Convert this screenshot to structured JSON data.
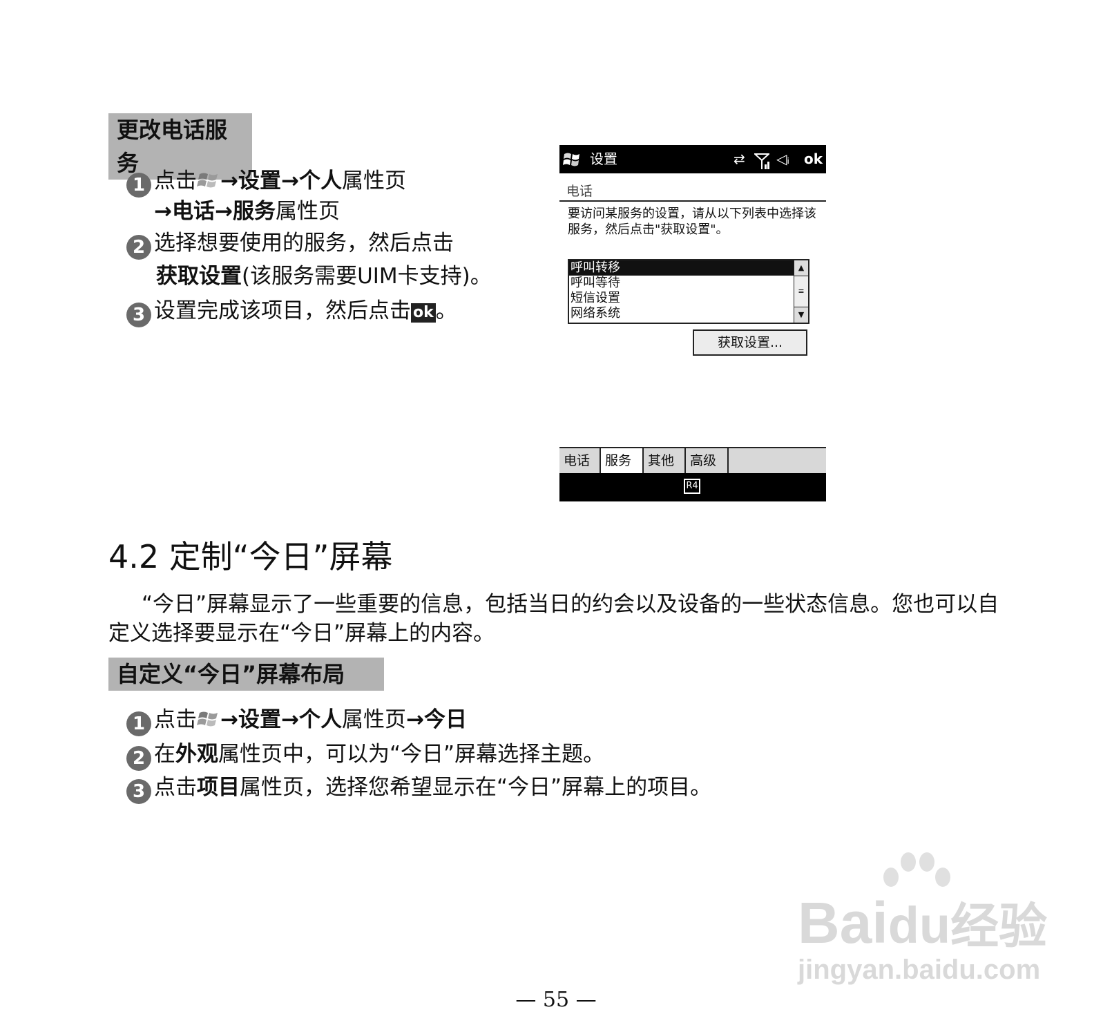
{
  "section1": {
    "label": "更改电话服务",
    "step1": {
      "num": "1",
      "pre": "点击",
      "arrow1": "→",
      "b1": "设置",
      "arrow2": "→",
      "b2": "个人",
      "tail": "属性页"
    },
    "step1b": {
      "arrow3": "→",
      "b3": "电话",
      "arrow4": "→",
      "b4": "服务",
      "tail": "属性页"
    },
    "step2": {
      "num": "2",
      "text": "选择想要使用的服务，然后点击"
    },
    "step2b": {
      "b": "获取设置",
      "tail": "(该服务需要UIM卡支持)。"
    },
    "step3": {
      "num": "3",
      "text": "设置完成该项目，然后点击",
      "ok": "ok",
      "end": "。"
    }
  },
  "phone": {
    "title": "设置",
    "status_icons": [
      "sync-icon",
      "signal-icon",
      "speaker-icon"
    ],
    "ok": "ok",
    "subtitle": "电话",
    "instruction": "要访问某服务的设置，请从以下列表中选择该服务，然后点击\"获取设置\"。",
    "services": [
      "呼叫转移",
      "呼叫等待",
      "短信设置",
      "网络系统"
    ],
    "selected_service": "呼叫转移",
    "get_button": "获取设置...",
    "tabs": [
      "电话",
      "服务",
      "其他",
      "高级"
    ],
    "active_tab": "服务",
    "kbd": "R4"
  },
  "section42": {
    "heading": "4.2 定制“今日”屏幕",
    "paragraph": "“今日”屏幕显示了一些重要的信息，包括当日的约会以及设备的一些状态信息。您也可以自定义选择要显示在“今日”屏幕上的内容。"
  },
  "section2": {
    "label": "自定义“今日”屏幕布局",
    "step1": {
      "num": "1",
      "pre": "点击",
      "arrow1": "→",
      "b1": "设置",
      "arrow2": "→",
      "b2": "个人",
      "mid": "属性页",
      "arrow3": "→",
      "b3": "今日"
    },
    "step2": {
      "num": "2",
      "pre": "在",
      "b": "外观",
      "tail": "属性页中，可以为“今日”屏幕选择主题。"
    },
    "step3": {
      "num": "3",
      "pre": "点击",
      "b": "项目",
      "tail": "属性页，选择您希望显示在“今日”屏幕上的项目。"
    }
  },
  "page_number": "— 55 —",
  "watermark": {
    "brand": "Bai",
    "brand2": "du",
    "cn": "经验",
    "url": "jingyan.baidu.com"
  }
}
